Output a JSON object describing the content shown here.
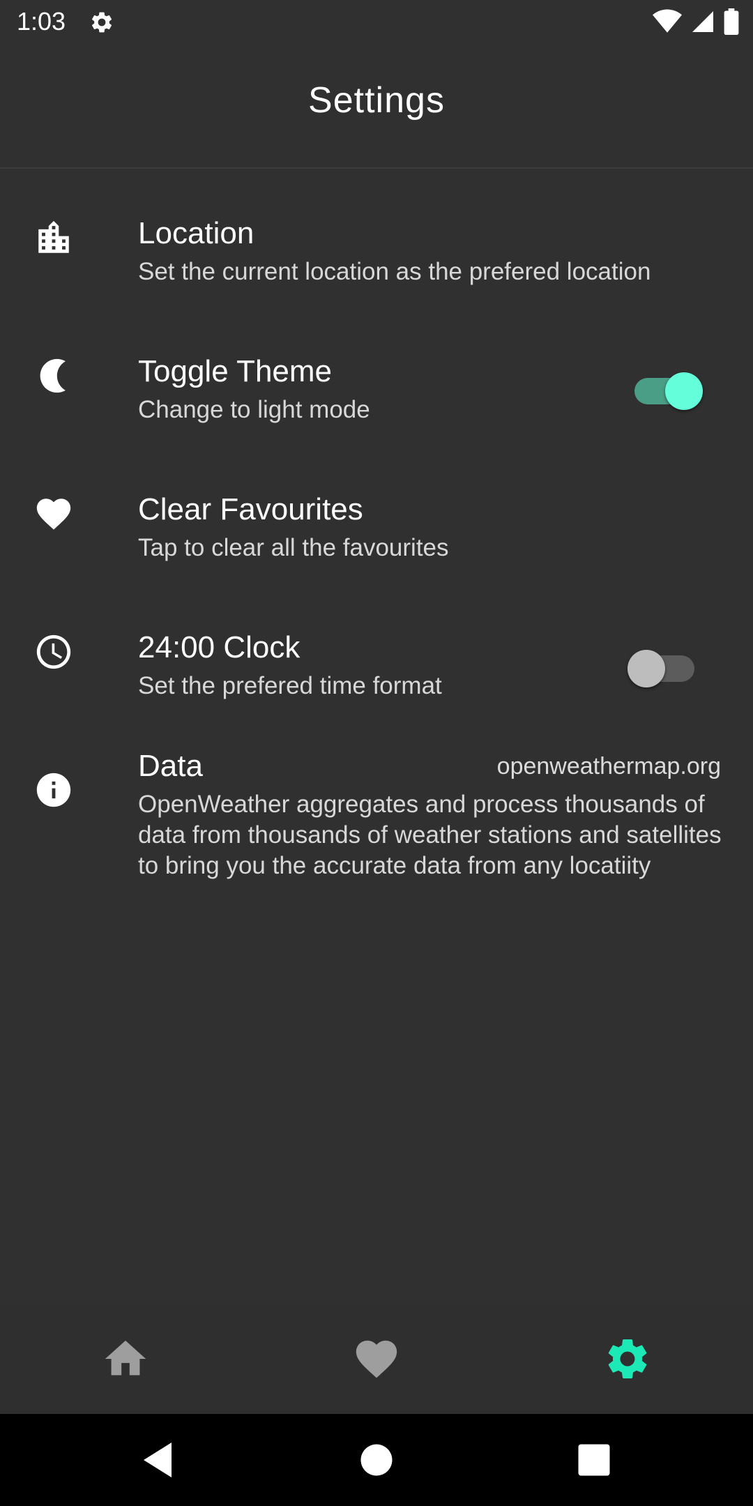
{
  "status_bar": {
    "time": "1:03"
  },
  "app_bar": {
    "title": "Settings"
  },
  "settings": {
    "location": {
      "title": "Location",
      "subtitle": "Set the current location as the prefered location",
      "icon": "city-icon"
    },
    "theme": {
      "title": "Toggle Theme",
      "subtitle": "Change to light mode",
      "icon": "moon-icon",
      "enabled": true
    },
    "favourites": {
      "title": "Clear Favourites",
      "subtitle": "Tap to clear all the favourites",
      "icon": "heart-icon"
    },
    "clock": {
      "title": "24:00 Clock",
      "subtitle": "Set the prefered time format",
      "icon": "clock-icon",
      "enabled": false
    },
    "data": {
      "title": "Data",
      "link": "openweathermap.org",
      "description": "OpenWeather aggregates and process thousands of data from thousands of weather stations and satellites to bring you the accurate data from any locatiity",
      "icon": "info-icon"
    }
  },
  "bottom_nav": {
    "items": [
      {
        "icon": "home-icon",
        "active": false
      },
      {
        "icon": "heart-icon",
        "active": false
      },
      {
        "icon": "gear-icon",
        "active": true
      }
    ]
  },
  "colors": {
    "background": "#303030",
    "accent": "#1de9b6",
    "toggle_on_thumb": "#64ffda",
    "toggle_on_track": "#4a9e86",
    "inactive_icon": "#9e9e9e"
  }
}
